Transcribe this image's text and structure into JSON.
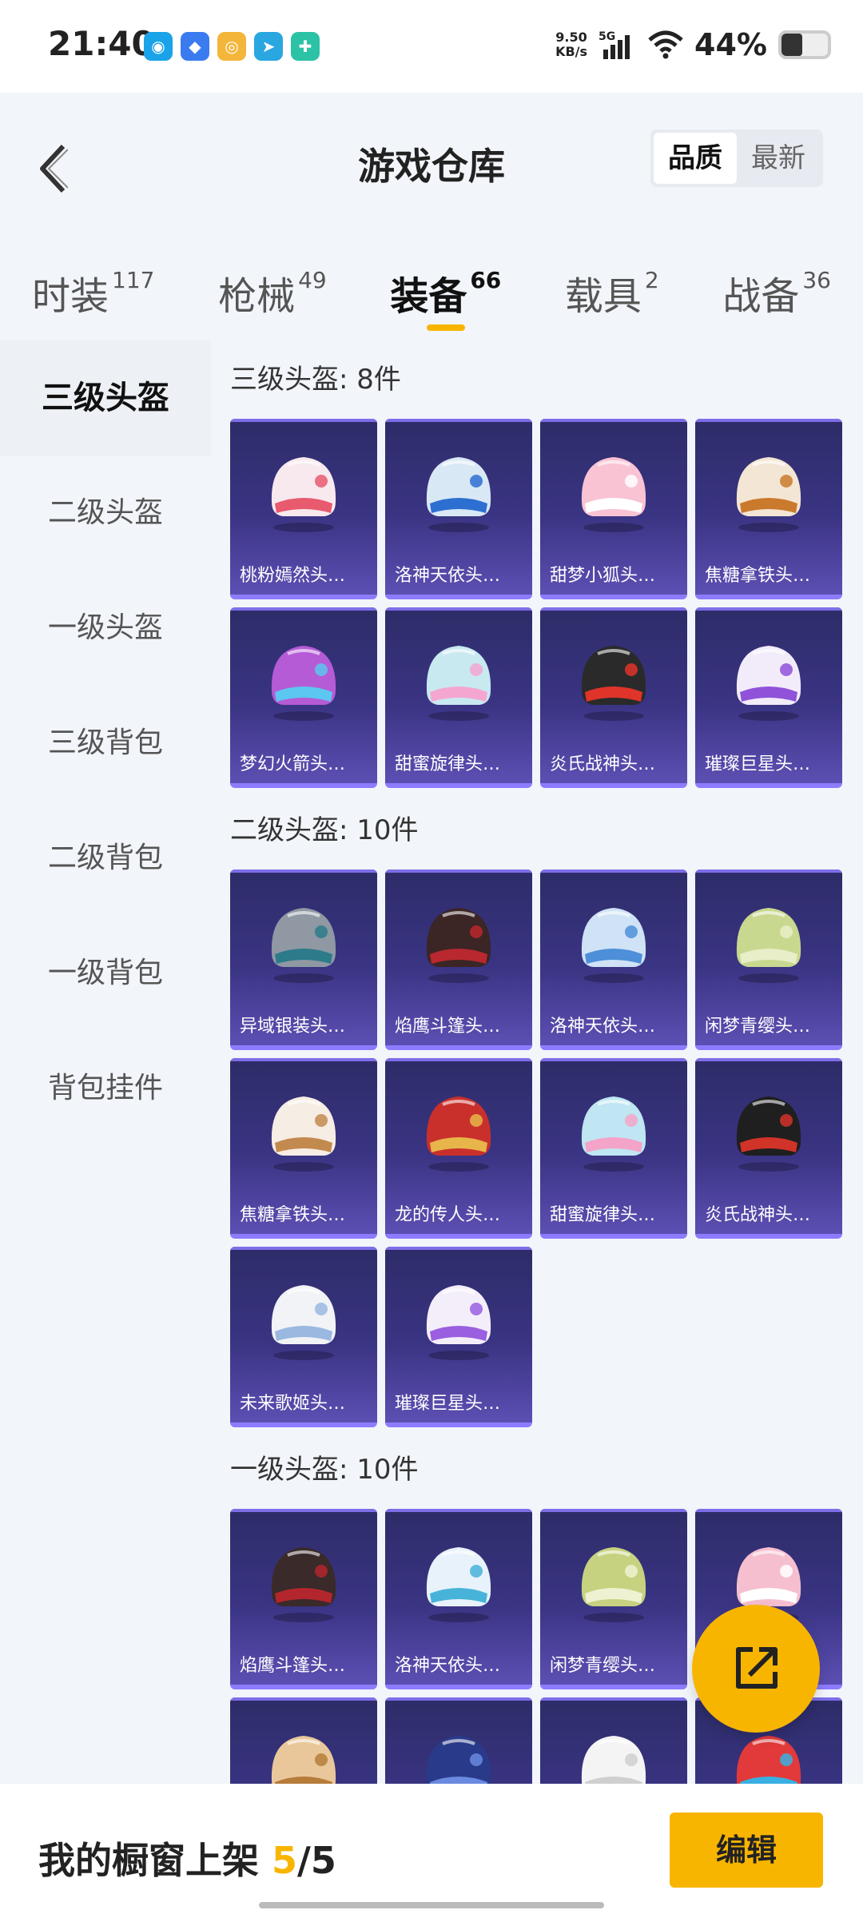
{
  "status": {
    "time": "21:40",
    "net_speed_value": "9.50",
    "net_speed_unit": "KB/s",
    "network": "5G",
    "battery_pct": "44%",
    "battery_level": 0.44
  },
  "header": {
    "title": "游戏仓库",
    "sort_options": [
      "品质",
      "最新"
    ]
  },
  "tabs": [
    {
      "label": "时装",
      "count": "117"
    },
    {
      "label": "枪械",
      "count": "49"
    },
    {
      "label": "装备",
      "count": "66"
    },
    {
      "label": "载具",
      "count": "2"
    },
    {
      "label": "战备",
      "count": "36"
    }
  ],
  "sidebar": {
    "items": [
      "三级头盔",
      "二级头盔",
      "一级头盔",
      "三级背包",
      "二级背包",
      "一级背包",
      "背包挂件"
    ]
  },
  "sections": [
    {
      "title": "三级头盔: 8件",
      "items": [
        {
          "name": "桃粉嫣然头…",
          "colors": [
            "#f7e9ee",
            "#e85a6e"
          ]
        },
        {
          "name": "洛神天依头…",
          "colors": [
            "#d9e8f5",
            "#2d6fd1"
          ]
        },
        {
          "name": "甜梦小狐头…",
          "colors": [
            "#f9c3d4",
            "#ffffff"
          ]
        },
        {
          "name": "焦糖拿铁头…",
          "colors": [
            "#f4e6d4",
            "#c97a2c"
          ]
        },
        {
          "name": "梦幻火箭头…",
          "colors": [
            "#b55bd6",
            "#5cc7f0"
          ]
        },
        {
          "name": "甜蜜旋律头…",
          "colors": [
            "#c8e9f0",
            "#f4a6d1"
          ]
        },
        {
          "name": "炎氏战神头…",
          "colors": [
            "#2a2a2a",
            "#e0342a"
          ]
        },
        {
          "name": "璀璨巨星头…",
          "colors": [
            "#f2ecfa",
            "#8f52d9"
          ]
        }
      ]
    },
    {
      "title": "二级头盔: 10件",
      "items": [
        {
          "name": "异域银装头…",
          "colors": [
            "#8f98a3",
            "#2c7b8a"
          ]
        },
        {
          "name": "焰鹰斗篷头…",
          "colors": [
            "#3b2525",
            "#b8282e"
          ]
        },
        {
          "name": "洛神天依头…",
          "colors": [
            "#cfe2f6",
            "#4d8fd8"
          ]
        },
        {
          "name": "闲梦青缨头…",
          "colors": [
            "#c9d88f",
            "#e8eec8"
          ]
        },
        {
          "name": "焦糖拿铁头…",
          "colors": [
            "#f6ede4",
            "#c38a4f"
          ]
        },
        {
          "name": "龙的传人头…",
          "colors": [
            "#c9302c",
            "#e8b54a"
          ]
        },
        {
          "name": "甜蜜旋律头…",
          "colors": [
            "#bfe6f2",
            "#f3a4c8"
          ]
        },
        {
          "name": "炎氏战神头…",
          "colors": [
            "#1f1f1f",
            "#d23328"
          ]
        },
        {
          "name": "未来歌姬头…",
          "colors": [
            "#f1f3f6",
            "#9ab8e0"
          ]
        },
        {
          "name": "璀璨巨星头…",
          "colors": [
            "#f4eefb",
            "#9a5fe0"
          ]
        }
      ]
    },
    {
      "title": "一级头盔: 10件",
      "items": [
        {
          "name": "焰鹰斗篷头…",
          "colors": [
            "#3a2a2a",
            "#b3262d"
          ]
        },
        {
          "name": "洛神天依头…",
          "colors": [
            "#e8f2fb",
            "#48b3d8"
          ]
        },
        {
          "name": "闲梦青缨头…",
          "colors": [
            "#c6d27f",
            "#eef2d2"
          ]
        },
        {
          "name": "",
          "colors": [
            "#f6bfd0",
            "#ffffff"
          ]
        },
        {
          "name": "",
          "colors": [
            "#e9c79a",
            "#b57c3a"
          ]
        },
        {
          "name": "",
          "colors": [
            "#2a3a8a",
            "#6a8ae0"
          ]
        },
        {
          "name": "",
          "colors": [
            "#f4f4f4",
            "#cfcfcf"
          ]
        },
        {
          "name": "",
          "colors": [
            "#e23a3a",
            "#3ab0e2"
          ]
        }
      ]
    }
  ],
  "bottom": {
    "shelf_label": "我的橱窗上架",
    "shelf_current": "5",
    "shelf_sep": "/",
    "shelf_total": "5",
    "edit_label": "编辑"
  }
}
